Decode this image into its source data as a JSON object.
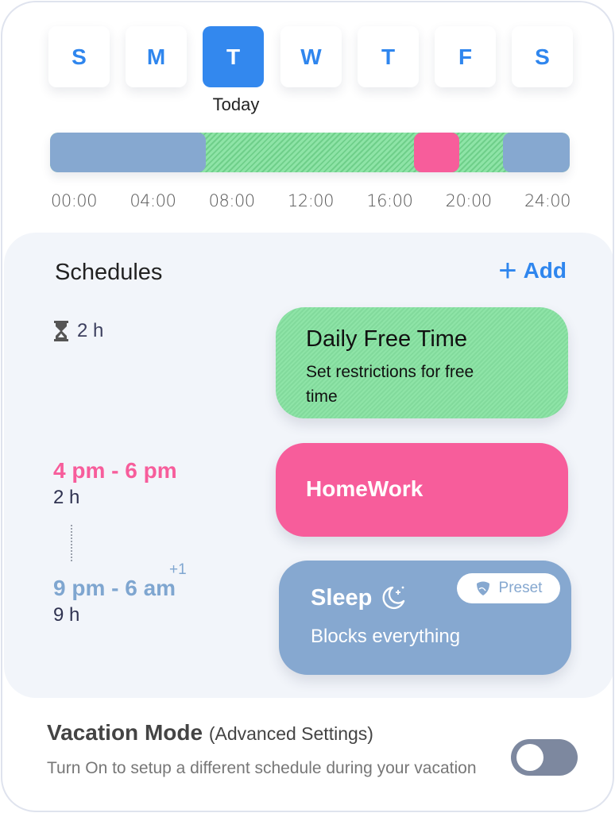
{
  "days": [
    {
      "label": "S",
      "active": false
    },
    {
      "label": "M",
      "active": false
    },
    {
      "label": "T",
      "active": true
    },
    {
      "label": "W",
      "active": false
    },
    {
      "label": "T",
      "active": false
    },
    {
      "label": "F",
      "active": false
    },
    {
      "label": "S",
      "active": false
    }
  ],
  "today_label": "Today",
  "timeline": {
    "ticks": [
      "00:00",
      "04:00",
      "08:00",
      "12:00",
      "16:00",
      "20:00",
      "24:00"
    ],
    "range_hours": [
      0,
      24
    ],
    "segments": [
      {
        "name": "sleep-morning",
        "start": 0,
        "end": 7.2,
        "color": "#86a8d0"
      },
      {
        "name": "homework",
        "start": 16.8,
        "end": 18.9,
        "color": "#f75d9b"
      },
      {
        "name": "sleep-night",
        "start": 20.9,
        "end": 24,
        "color": "#86a8d0"
      }
    ],
    "free_time_color": "#8ee4a7"
  },
  "schedules": {
    "title": "Schedules",
    "add_label": "Add",
    "items": [
      {
        "title": "Daily Free Time",
        "subtitle": "Set restrictions for free time",
        "duration": "2 h",
        "icon": "hourglass-icon",
        "color": "#8ee4a7"
      },
      {
        "title": "HomeWork",
        "time_range": "4 pm - 6 pm",
        "duration": "2 h",
        "range_color": "#f75d9b",
        "color": "#f75d9b"
      },
      {
        "title": "Sleep",
        "subtitle": "Blocks everything",
        "time_range": "9 pm - 6 am",
        "next_day": "+1",
        "duration": "9 h",
        "badge": "Preset",
        "icon": "moon-stars-icon",
        "range_color": "#7fa6d0",
        "color": "#86a8d0"
      }
    ]
  },
  "vacation": {
    "title": "Vacation Mode",
    "subtitle": "(Advanced Settings)",
    "description": "Turn On to setup a different schedule during your vacation",
    "enabled": false
  },
  "colors": {
    "accent": "#2f86ee",
    "active_day": "#3388ee"
  }
}
